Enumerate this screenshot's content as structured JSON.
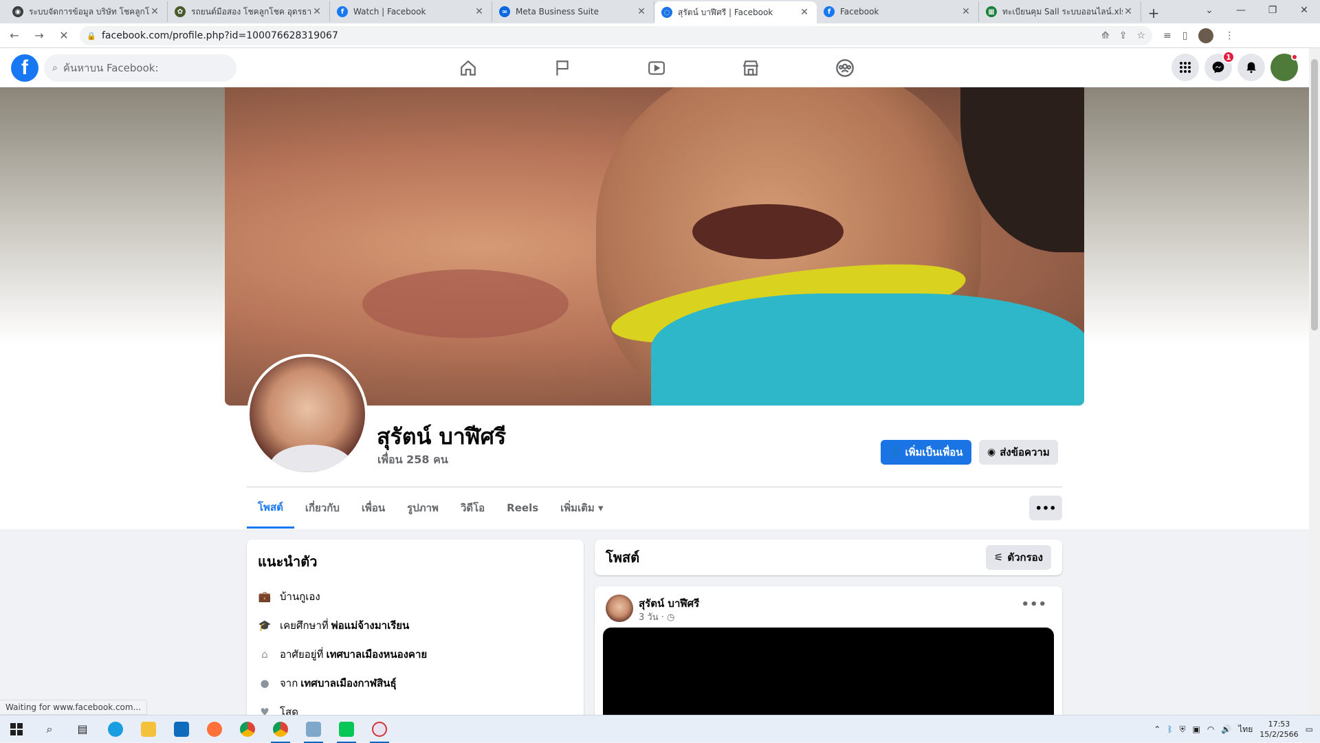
{
  "browser": {
    "tabs": [
      {
        "title": "ระบบจัดการข้อมูล บริษัท โชคลูกโชค",
        "favicon_color": "#3c4043",
        "favicon_glyph": "◉"
      },
      {
        "title": "รถยนต์มือสอง โชคลูกโชค อุดรธานี",
        "favicon_color": "#4a5a2a",
        "favicon_glyph": "✿"
      },
      {
        "title": "Watch | Facebook",
        "favicon_color": "#1877f2",
        "favicon_glyph": "f"
      },
      {
        "title": "Meta Business Suite",
        "favicon_color": "#0668e1",
        "favicon_glyph": "∞"
      },
      {
        "title": "สุรัตน์ บาฬีศรี | Facebook",
        "favicon_color": "#1a73e8",
        "favicon_glyph": "◌"
      },
      {
        "title": "Facebook",
        "favicon_color": "#1877f2",
        "favicon_glyph": "f"
      },
      {
        "title": "ทะเบียนคุม Sall ระบบออนไลน์.xlsx - G",
        "favicon_color": "#188038",
        "favicon_glyph": "▦"
      }
    ],
    "active_tab_index": 4,
    "new_tab_label": "+",
    "url": "facebook.com/profile.php?id=100076628319067",
    "status_text": "Waiting for www.facebook.com..."
  },
  "facebook": {
    "logo_letter": "f",
    "search_placeholder": "ค้นหาบน Facebook:",
    "messenger_badge": "1"
  },
  "profile": {
    "name": "สุรัตน์ บาฬีศรี",
    "friends": "เพื่อน 258 คน",
    "add_friend_label": "เพิ่มเป็นเพื่อน",
    "message_label": "ส่งข้อความ",
    "tabs": [
      {
        "label": "โพสต์",
        "active": true
      },
      {
        "label": "เกี่ยวกับ",
        "active": false
      },
      {
        "label": "เพื่อน",
        "active": false
      },
      {
        "label": "รูปภาพ",
        "active": false
      },
      {
        "label": "วิดีโอ",
        "active": false
      },
      {
        "label": "Reels",
        "active": false
      },
      {
        "label": "เพิ่มเติม ▾",
        "active": false
      }
    ]
  },
  "intro": {
    "title": "แนะนำตัว",
    "items": [
      {
        "icon": "briefcase-icon",
        "glyph": "💼",
        "prefix": "บ้านกูเอง",
        "bold": ""
      },
      {
        "icon": "graduation-cap-icon",
        "glyph": "🎓",
        "prefix": "เคยศึกษาที่",
        "bold": "พ่อแม่จ้างมาเรียน"
      },
      {
        "icon": "home-icon",
        "glyph": "⌂",
        "prefix": "อาศัยอยู่ที่",
        "bold": "เทศบาลเมืองหนองคาย"
      },
      {
        "icon": "location-pin-icon",
        "glyph": "●",
        "prefix": "จาก",
        "bold": "เทศบาลเมืองกาฬสินธุ์"
      },
      {
        "icon": "heart-icon",
        "glyph": "♥",
        "prefix": "โสด",
        "bold": ""
      }
    ]
  },
  "posts": {
    "title": "โพสต์",
    "filter_label": "ตัวกรอง",
    "first_post": {
      "author": "สุรัตน์ บาฬีศรี",
      "meta": "3 วัน · ◷"
    }
  },
  "taskbar": {
    "language": "ไทย",
    "time": "17:53",
    "date": "15/2/2566"
  }
}
